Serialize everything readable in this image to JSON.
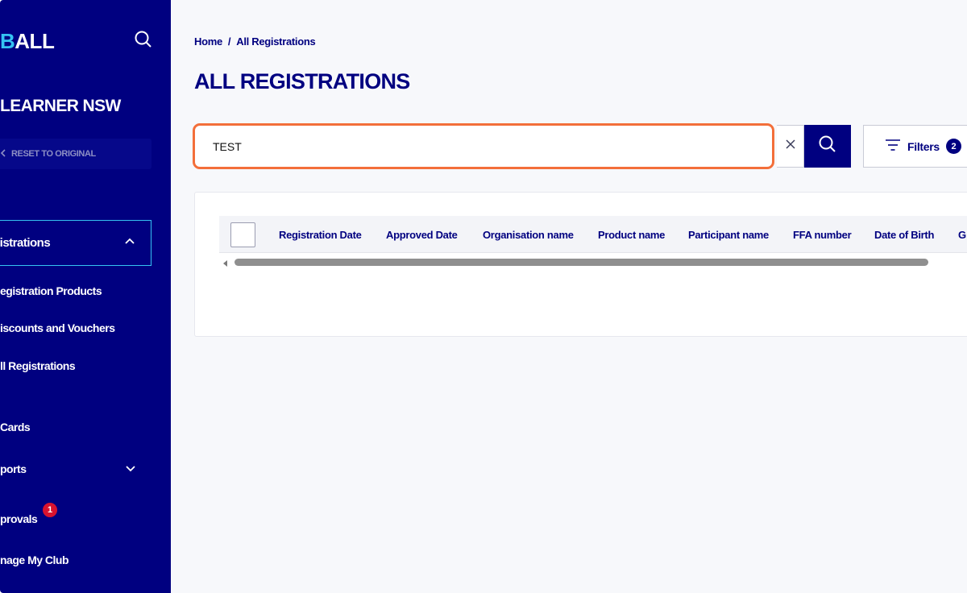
{
  "sidebar": {
    "logo_accent": "B",
    "logo_rest": "ALL",
    "org_name": "LEARNER NSW",
    "reset_label": "RESET TO ORIGINAL",
    "items": [
      {
        "label": "gistrations"
      },
      {
        "label": "egistration Products"
      },
      {
        "label": "iscounts and Vouchers"
      },
      {
        "label": "ll Registrations"
      },
      {
        "label": "Cards"
      },
      {
        "label": "ports"
      },
      {
        "label": "provals"
      },
      {
        "label": "nage My Club"
      }
    ],
    "approvals_badge": "1"
  },
  "breadcrumb": {
    "home": "Home",
    "separator": "/",
    "current": "All Registrations"
  },
  "page_title": "ALL REGISTRATIONS",
  "search": {
    "value": "TEST",
    "placeholder": ""
  },
  "filters": {
    "label": "Filters",
    "count": "2"
  },
  "table": {
    "columns": [
      "Registration Date",
      "Approved Date",
      "Organisation name",
      "Product name",
      "Participant name",
      "FFA number",
      "Date of Birth",
      "G"
    ]
  },
  "colors": {
    "sidebar_bg": "#000080",
    "accent": "#35c3f2",
    "highlight": "#f36f3a",
    "badge_red": "#d8132f"
  }
}
